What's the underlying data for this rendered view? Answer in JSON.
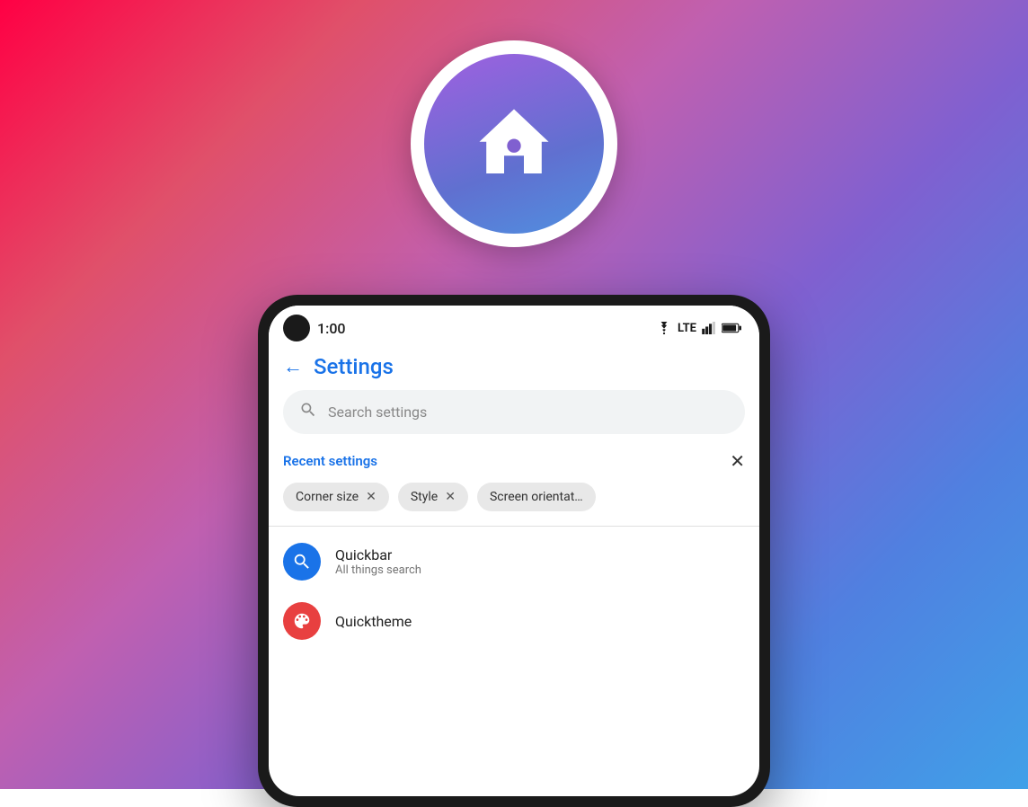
{
  "background": {
    "gradient_start": "#ff0044",
    "gradient_end": "#40a0e8"
  },
  "app_icon": {
    "alt": "Launcher app icon"
  },
  "status_bar": {
    "time": "1:00",
    "lte_label": "LTE",
    "wifi_symbol": "⌐",
    "battery_symbol": "▮"
  },
  "header": {
    "back_label": "←",
    "title": "Settings"
  },
  "search": {
    "placeholder": "Search settings",
    "icon": "search"
  },
  "recent_settings": {
    "label": "Recent settings",
    "close_label": "✕",
    "chips": [
      {
        "label": "Corner size",
        "removable": true
      },
      {
        "label": "Style",
        "removable": true
      },
      {
        "label": "Screen orientat…",
        "removable": false
      }
    ]
  },
  "settings_items": [
    {
      "name": "Quickbar",
      "description": "All things search",
      "icon_type": "search",
      "icon_color": "blue"
    },
    {
      "name": "Quicktheme",
      "description": "",
      "icon_type": "palette",
      "icon_color": "red"
    }
  ]
}
